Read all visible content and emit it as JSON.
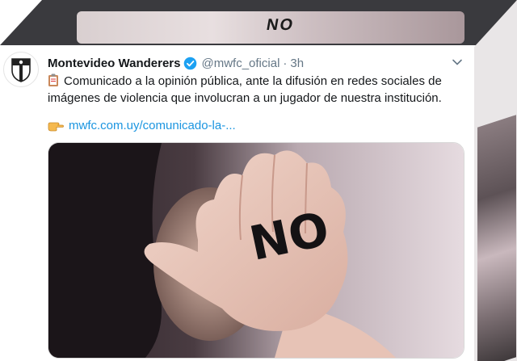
{
  "tweet": {
    "display_name": "Montevideo Wanderers",
    "handle": "@mwfc_oficial",
    "separator": "·",
    "time": "3h",
    "text": "Comunicado a la opinión pública, ante la difusión en redes sociales de imágenes de violencia que involucran a un jugador de nuestra institución.",
    "link": "mwfc.com.uy/comunicado-la-...",
    "image_text": "NO"
  },
  "icons": {
    "verified": "verified-badge-icon",
    "caret": "chevron-down-icon",
    "clipboard": "clipboard-emoji-icon",
    "pointing_hand": "pointing-right-emoji-icon"
  },
  "colors": {
    "link": "#1b95e0",
    "verified": "#1da1f2",
    "name": "#14171a",
    "secondary": "#657786"
  }
}
